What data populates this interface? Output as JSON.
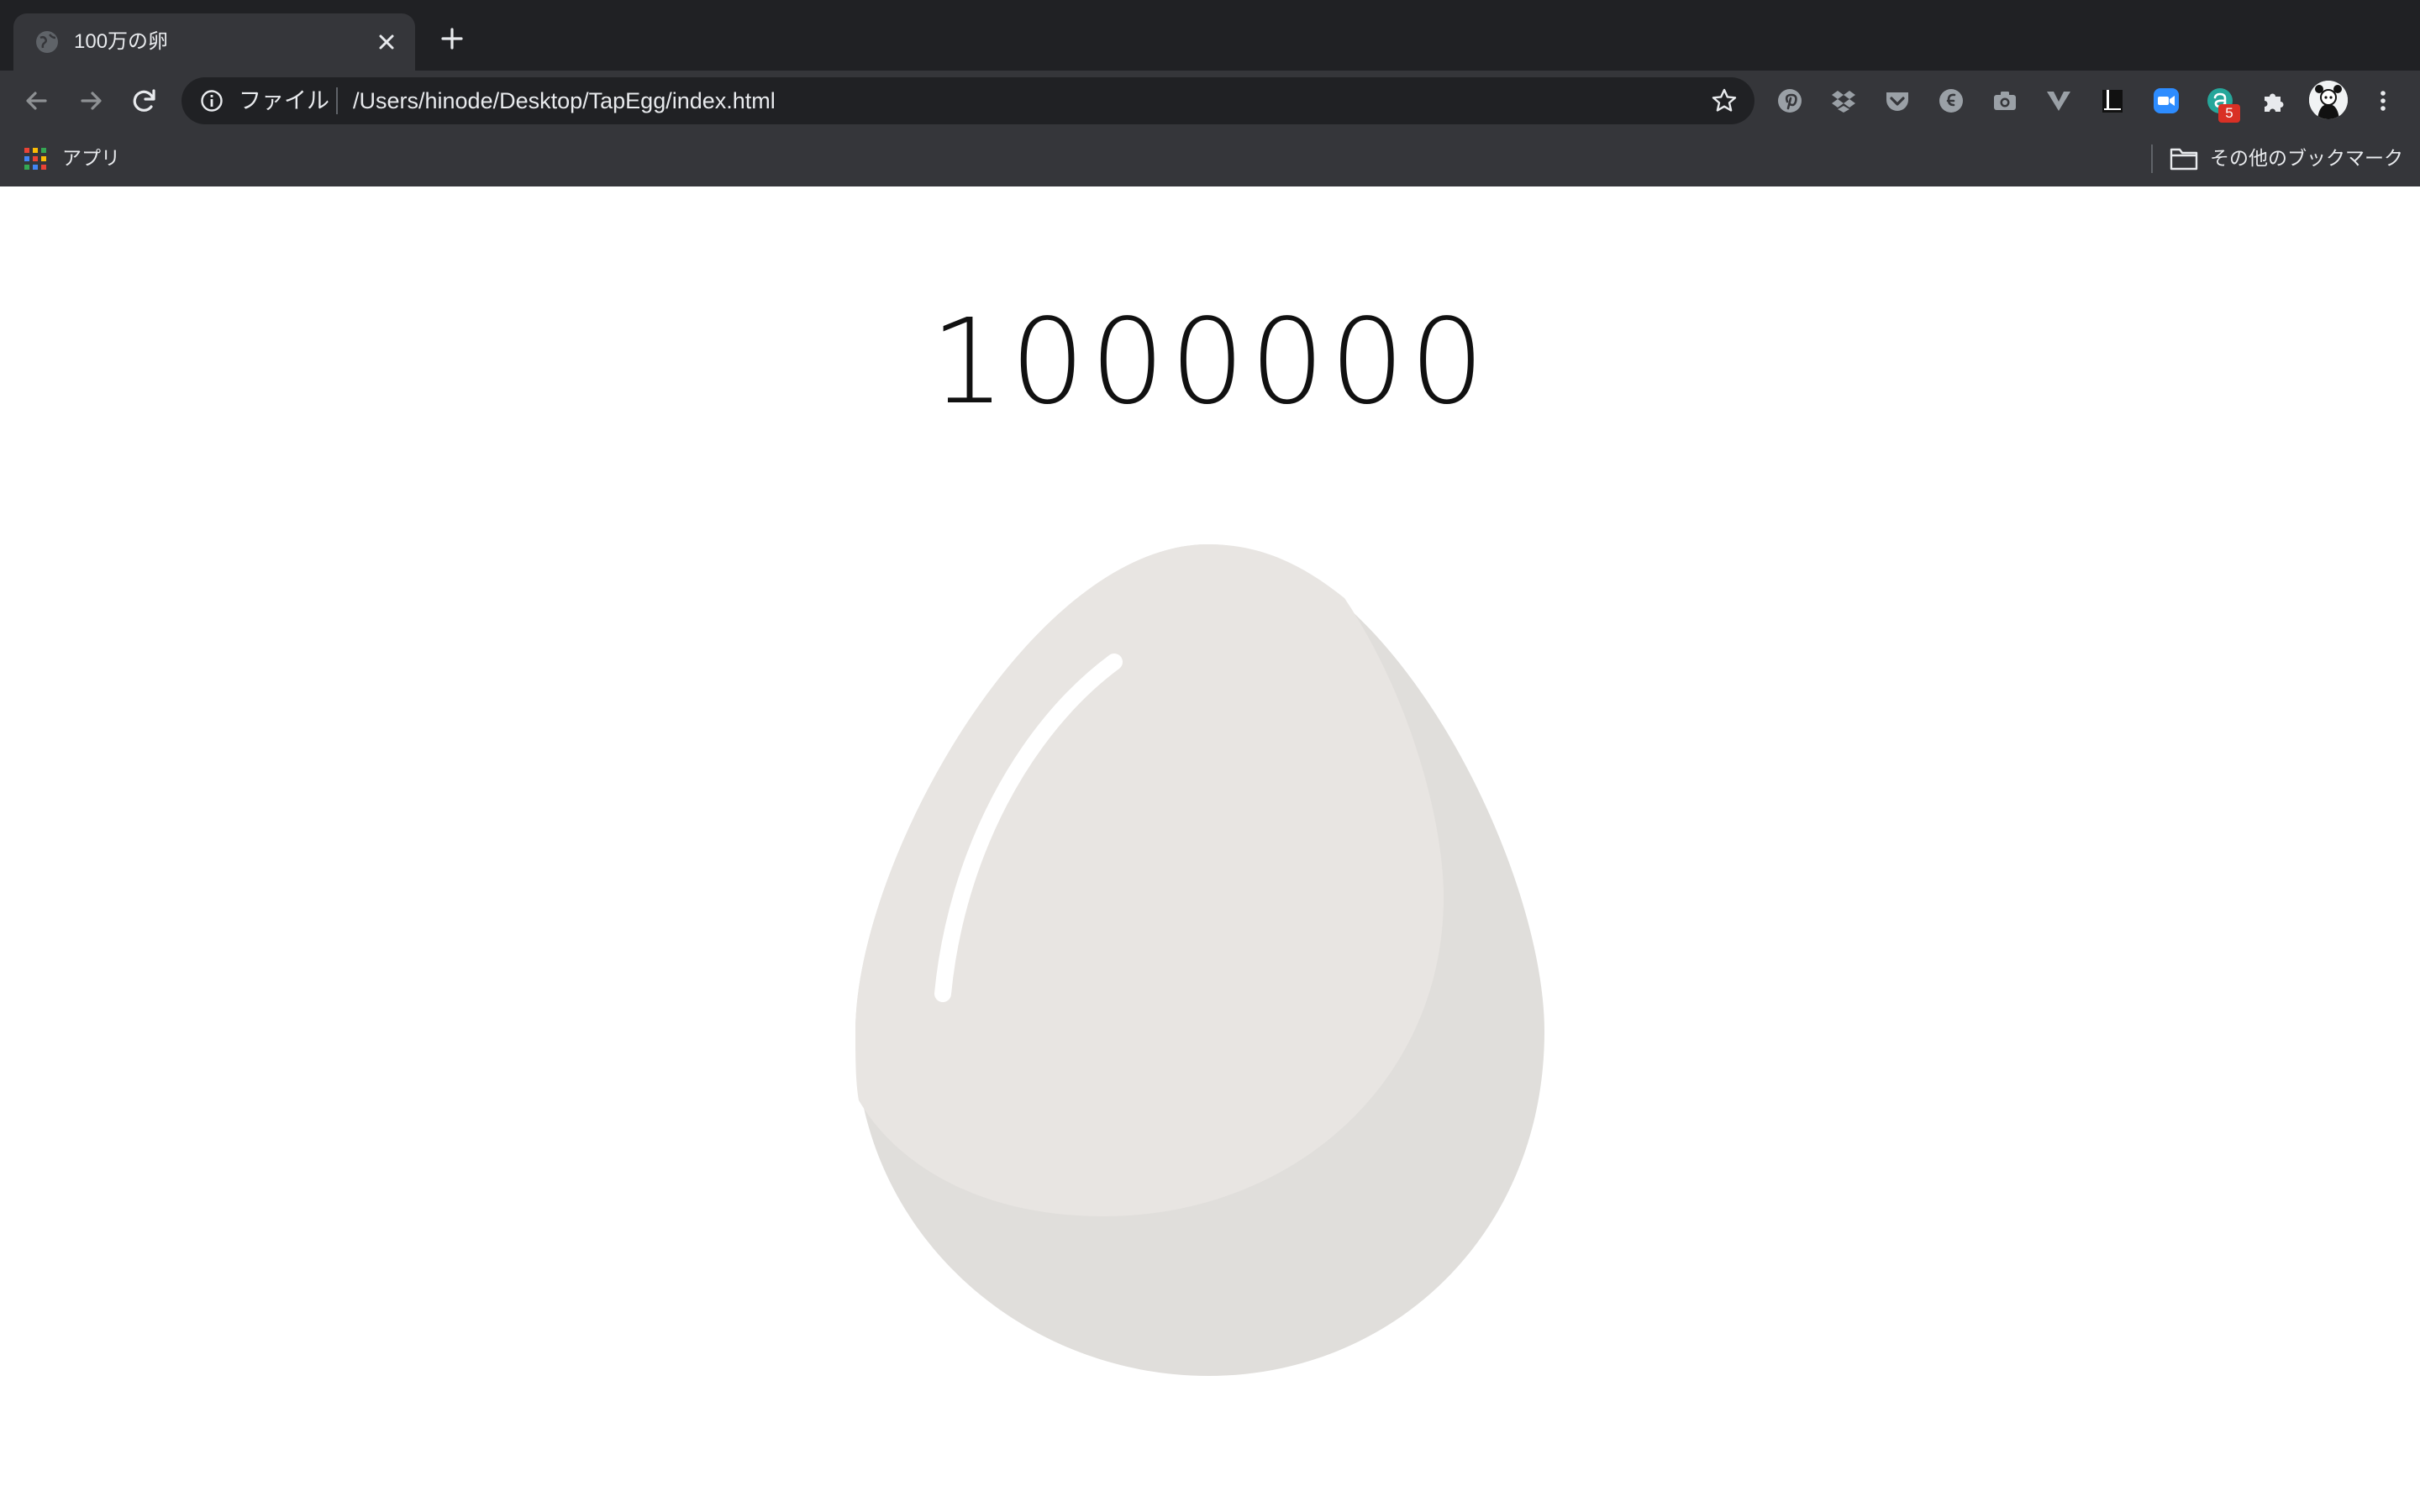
{
  "tab": {
    "title": "100万の卵",
    "favicon": "globe-icon"
  },
  "toolbar": {
    "back_icon": "back-arrow-icon",
    "forward_icon": "forward-arrow-icon",
    "reload_icon": "reload-icon"
  },
  "omnibox": {
    "scheme_label": "ファイル",
    "url": "/Users/hinode/Desktop/TapEgg/index.html"
  },
  "extensions": {
    "icons": [
      "pinterest-icon",
      "dropbox-icon",
      "pocket-icon",
      "evernote-icon",
      "camera-icon",
      "vivaldi-v-icon",
      "bookmark-book-icon",
      "zoom-video-icon",
      "extension-a-icon",
      "puzzle-icon"
    ],
    "badge": "5"
  },
  "bookmarks": {
    "apps_label": "アプリ",
    "other_label": "その他のブックマーク"
  },
  "page": {
    "counter": "1000000"
  },
  "colors": {
    "chrome_dark": "#202124",
    "chrome_toolbar": "#35363a",
    "egg_light": "#e8e5e2",
    "egg_shade": "#e0dedb",
    "egg_highlight": "#ffffff"
  }
}
